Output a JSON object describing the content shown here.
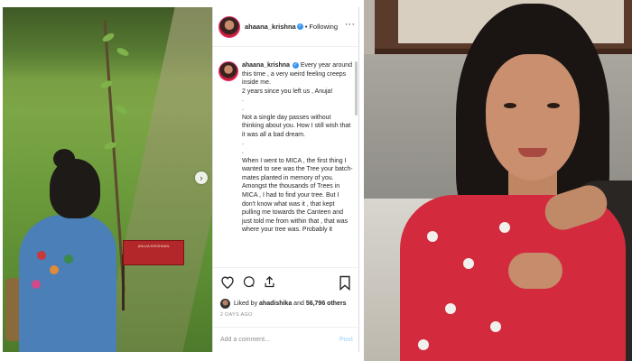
{
  "post": {
    "username": "ahaana_krishna",
    "follow_label": "Following",
    "caption_username": "ahaana_krishna",
    "caption_text": "Every year around this time , a very weird feeling creeps inside me.\n2 years since you left us , Anuja!\n.\n.\nNot a single day passes without thinking about you. How I still wish that it was all a bad dream.\n.\n.\nWhen I went to MICA , the first thing I wanted to see was the Tree your batch-mates planted in memory of you. Amongst the thousands of Trees in MICA , I had to find your tree. But I don't know what was it , that kept pulling me towards the Canteen and just told me from within that , that was where your tree was. Probably it",
    "liked_by_prefix": "Liked by",
    "liked_by_user": "ahadishika",
    "liked_by_and": "and",
    "liked_by_count": "56,796 others",
    "time_ago": "2 DAYS AGO",
    "add_comment_placeholder": "Add a comment...",
    "post_button": "Post"
  },
  "sign_text": "ANUJA KRISHNAN",
  "icons": {
    "more": "more-horizontal-icon",
    "like": "heart-icon",
    "comment": "comment-icon",
    "share": "share-icon",
    "save": "bookmark-icon",
    "verified": "verified-badge-icon",
    "next": "chevron-right-icon"
  },
  "colors": {
    "verified_blue": "#3897f0",
    "post_disabled": "#b2dffc",
    "text_primary": "#262626",
    "text_secondary": "#8e8e8e"
  }
}
